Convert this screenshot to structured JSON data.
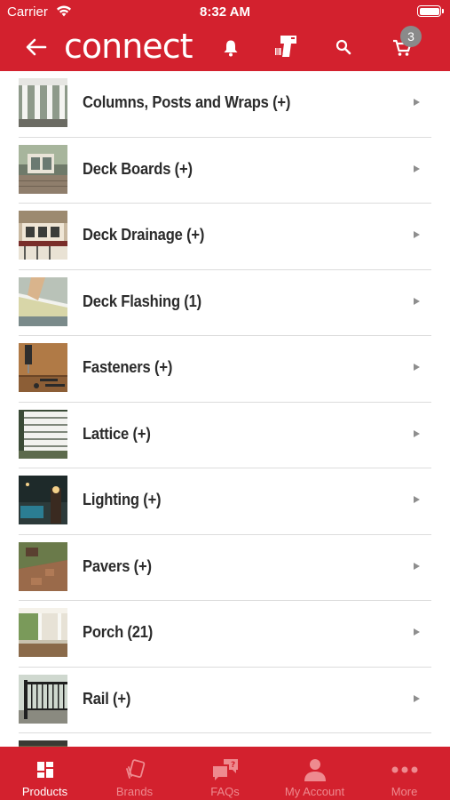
{
  "status_bar": {
    "carrier": "Carrier",
    "time": "8:32 AM"
  },
  "nav": {
    "logo_text": "connect",
    "cart_count": "3"
  },
  "categories": [
    {
      "label": "Columns, Posts and Wraps (+)"
    },
    {
      "label": "Deck Boards (+)"
    },
    {
      "label": "Deck Drainage (+)"
    },
    {
      "label": "Deck Flashing (1)"
    },
    {
      "label": "Fasteners (+)"
    },
    {
      "label": "Lattice (+)"
    },
    {
      "label": "Lighting (+)"
    },
    {
      "label": "Pavers (+)"
    },
    {
      "label": "Porch (21)"
    },
    {
      "label": "Rail (+)"
    }
  ],
  "tabs": [
    {
      "label": "Products",
      "active": true
    },
    {
      "label": "Brands",
      "active": false
    },
    {
      "label": "FAQs",
      "active": false
    },
    {
      "label": "My Account",
      "active": false
    },
    {
      "label": "More",
      "active": false
    }
  ],
  "colors": {
    "brand_red": "#d3212e",
    "inactive_tab": "#ee8a8f",
    "badge_gray": "#8a8a8a"
  }
}
